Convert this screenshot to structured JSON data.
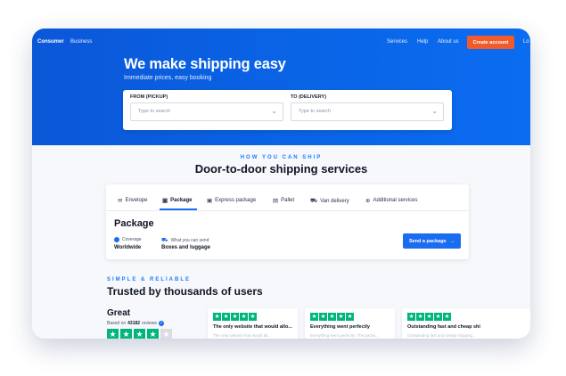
{
  "nav": {
    "left": [
      "Consumer",
      "Business"
    ],
    "right": [
      "Services",
      "Help",
      "About us"
    ],
    "cta": "Create account",
    "truncated": "Lo"
  },
  "hero": {
    "title": "We make shipping easy",
    "subtitle": "Immediate prices, easy booking"
  },
  "search": {
    "from_label": "FROM (PICKUP)",
    "from_placeholder": "Type to search",
    "to_label": "TO (DELIVERY)",
    "to_placeholder": "Type to search"
  },
  "services": {
    "eyebrow": "HOW YOU CAN SHIP",
    "title": "Door-to-door shipping services",
    "tabs": [
      {
        "label": "Envelope",
        "icon": "envelope-icon"
      },
      {
        "label": "Package",
        "icon": "package-icon",
        "active": true
      },
      {
        "label": "Express package",
        "icon": "express-package-icon"
      },
      {
        "label": "Pallet",
        "icon": "pallet-icon"
      },
      {
        "label": "Van delivery",
        "icon": "van-icon"
      },
      {
        "label": "Additional services",
        "icon": "plus-circle-icon"
      }
    ],
    "panel_title": "Package",
    "coverage_label": "Coverage",
    "coverage_value": "Worldwide",
    "send_label": "What you can send",
    "send_value": "Boxes and luggage",
    "button": "Send a package"
  },
  "trust": {
    "eyebrow": "SIMPLE & RELIABLE",
    "title": "Trusted by thousands of users",
    "rating_word": "Great",
    "based_on": "Based on",
    "review_count": "43182",
    "reviews_word": "reviews",
    "stars_filled": 4,
    "reviews": [
      {
        "title": "The only website that would allo...",
        "text": "The only website that would all..."
      },
      {
        "title": "Everything went perfectly",
        "text": "Everything went perfectly. The packa..."
      },
      {
        "title": "Outstanding fast and cheap shi",
        "text": "Outstanding fast and cheap shipping..."
      }
    ]
  },
  "colors": {
    "brand_blue": "#0b57d8",
    "cta_orange": "#f15b2b",
    "trustpilot_green": "#00b67a"
  }
}
